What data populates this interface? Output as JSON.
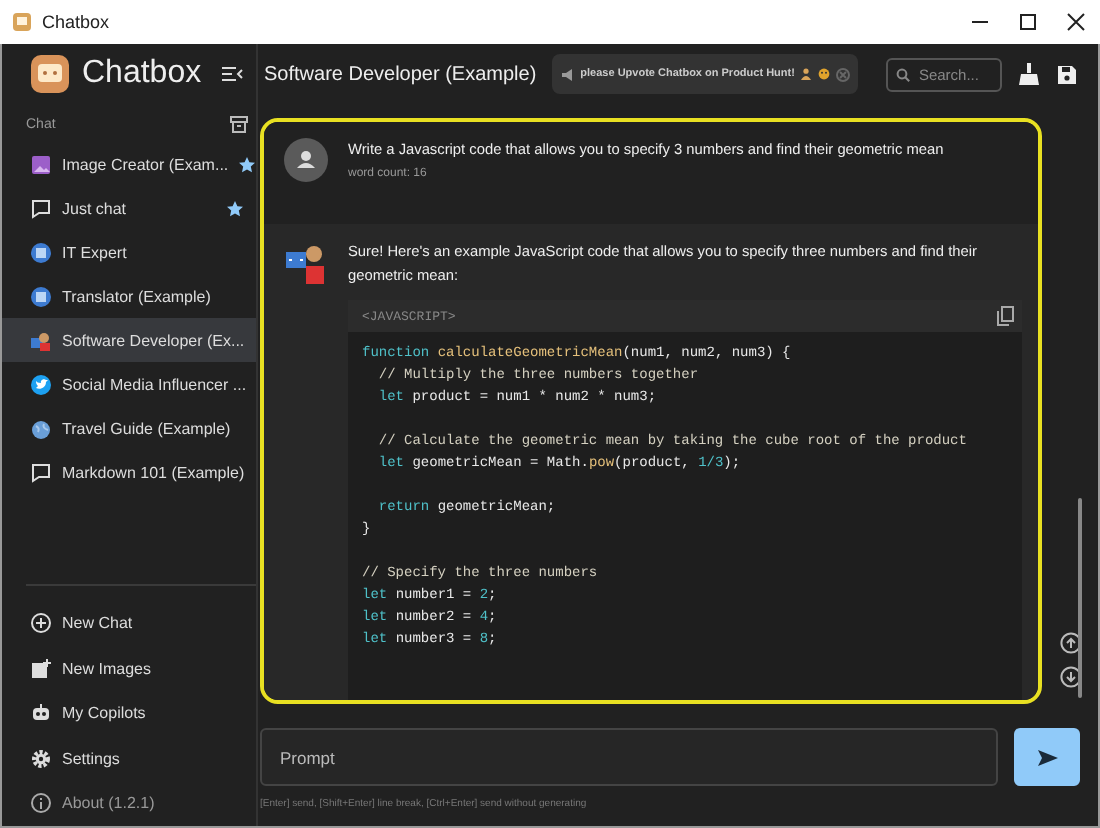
{
  "window": {
    "title": "Chatbox"
  },
  "sidebar": {
    "app_name": "Chatbox",
    "section_label": "Chat",
    "sessions": [
      {
        "label": "Image Creator (Exam...",
        "kind": "image",
        "starred": true,
        "selected": false
      },
      {
        "label": "Just chat",
        "kind": "bubble",
        "starred": true,
        "selected": false
      },
      {
        "label": "IT Expert",
        "kind": "avatar",
        "starred": false,
        "selected": false
      },
      {
        "label": "Translator (Example)",
        "kind": "avatar",
        "starred": false,
        "selected": false
      },
      {
        "label": "Software Developer (Ex...",
        "kind": "developer",
        "starred": false,
        "selected": true
      },
      {
        "label": "Social Media Influencer ...",
        "kind": "bird",
        "starred": false,
        "selected": false
      },
      {
        "label": "Travel Guide (Example)",
        "kind": "globe",
        "starred": false,
        "selected": false
      },
      {
        "label": "Markdown 101 (Example)",
        "kind": "bubble",
        "starred": false,
        "selected": false
      }
    ],
    "actions": [
      {
        "label": "New Chat",
        "kind": "plus",
        "disabled": false
      },
      {
        "label": "New Images",
        "kind": "images",
        "disabled": false
      },
      {
        "label": "My Copilots",
        "kind": "robot",
        "disabled": false
      },
      {
        "label": "Settings",
        "kind": "gear",
        "disabled": false
      },
      {
        "label": "About (1.2.1)",
        "kind": "info",
        "disabled": true
      }
    ]
  },
  "header": {
    "title": "Software Developer (Example)",
    "notice": "please Upvote Chatbox on Product Hunt!",
    "search": {
      "placeholder": "Search..."
    }
  },
  "messages": [
    {
      "kind": "user",
      "text": "Write a Javascript code that allows you to specify 3 numbers and find their geometric mean",
      "meta": "word count: 16"
    },
    {
      "kind": "assistant",
      "text": "Sure! Here's an example JavaScript code that allows you to specify three numbers and find their geometric mean:",
      "code": {
        "language": "<JAVASCRIPT>",
        "lines": [
          {
            "kind": "code",
            "tokens": [
              {
                "kind": "keyword",
                "text": "function "
              },
              {
                "kind": "func",
                "text": "calculateGeometricMean"
              },
              {
                "kind": "plain",
                "text": "(num1, num2, num3) {"
              }
            ]
          },
          {
            "kind": "code",
            "tokens": [
              {
                "kind": "comment",
                "text": "  // Multiply the three numbers together"
              }
            ]
          },
          {
            "kind": "code",
            "tokens": [
              {
                "kind": "keyword",
                "text": "  let "
              },
              {
                "kind": "plain",
                "text": "product = num1 * num2 * num3;"
              }
            ]
          },
          {
            "kind": "blank"
          },
          {
            "kind": "code",
            "tokens": [
              {
                "kind": "comment",
                "text": "  // Calculate the geometric mean by taking the cube root of the product"
              }
            ]
          },
          {
            "kind": "code",
            "tokens": [
              {
                "kind": "keyword",
                "text": "  let "
              },
              {
                "kind": "plain",
                "text": "geometricMean = Math."
              },
              {
                "kind": "func",
                "text": "pow"
              },
              {
                "kind": "plain",
                "text": "(product, "
              },
              {
                "kind": "number",
                "text": "1/3"
              },
              {
                "kind": "plain",
                "text": ");"
              }
            ]
          },
          {
            "kind": "blank"
          },
          {
            "kind": "code",
            "tokens": [
              {
                "kind": "keyword",
                "text": "  return "
              },
              {
                "kind": "plain",
                "text": "geometricMean;"
              }
            ]
          },
          {
            "kind": "code",
            "tokens": [
              {
                "kind": "plain",
                "text": "}"
              }
            ]
          },
          {
            "kind": "blank"
          },
          {
            "kind": "code",
            "tokens": [
              {
                "kind": "comment",
                "text": "// Specify the three numbers"
              }
            ]
          },
          {
            "kind": "code",
            "tokens": [
              {
                "kind": "keyword",
                "text": "let "
              },
              {
                "kind": "plain",
                "text": "number1 = "
              },
              {
                "kind": "number",
                "text": "2"
              },
              {
                "kind": "plain",
                "text": ";"
              }
            ]
          },
          {
            "kind": "code",
            "tokens": [
              {
                "kind": "keyword",
                "text": "let "
              },
              {
                "kind": "plain",
                "text": "number2 = "
              },
              {
                "kind": "number",
                "text": "4"
              },
              {
                "kind": "plain",
                "text": ";"
              }
            ]
          },
          {
            "kind": "code",
            "tokens": [
              {
                "kind": "keyword",
                "text": "let "
              },
              {
                "kind": "plain",
                "text": "number3 = "
              },
              {
                "kind": "number",
                "text": "8"
              },
              {
                "kind": "plain",
                "text": ";"
              }
            ]
          }
        ]
      }
    }
  ],
  "composer": {
    "placeholder": "Prompt",
    "hint": "[Enter] send, [Shift+Enter] line break, [Ctrl+Enter] send without generating"
  }
}
